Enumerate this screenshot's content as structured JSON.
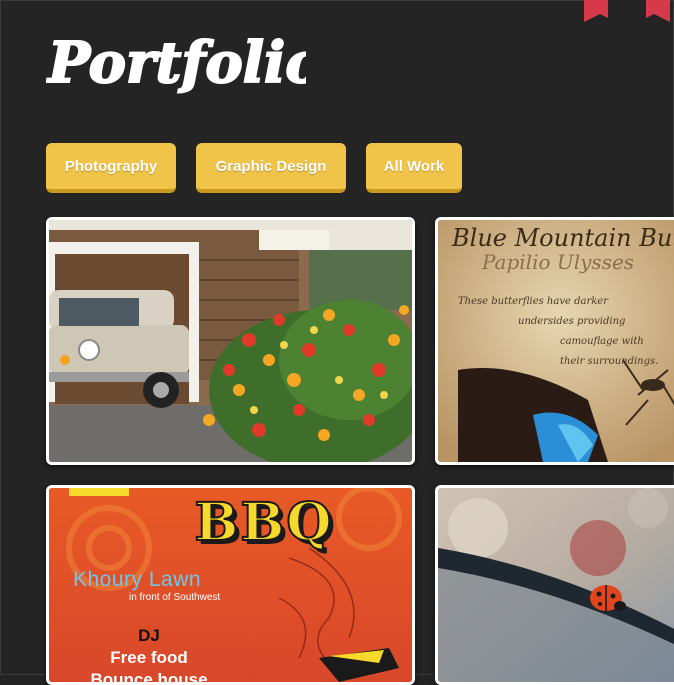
{
  "site": {
    "logo_text": "Portfolio",
    "ribbon_color": "#d63a4a"
  },
  "filters": [
    {
      "label": "Photography"
    },
    {
      "label": "Graphic Design"
    },
    {
      "label": "All Work"
    }
  ],
  "colors": {
    "background": "#252424",
    "button": "#f0c449",
    "button_shadow": "#c99a1f",
    "tile_border": "#ffffff"
  },
  "tiles": {
    "car_photo": {
      "subject": "vintage car and flowers"
    },
    "butterfly": {
      "title": "Blue Mountain But",
      "subtitle": "Papilio Ulysses",
      "note_lines": [
        "These butterflies have darker",
        "undersides providing",
        "camouflage with",
        "their surroundings."
      ]
    },
    "bbq_poster": {
      "title": "BBQ",
      "location": "Khoury Lawn",
      "location_detail": "in front of Southwest",
      "lines": [
        "DJ",
        "Free food",
        "Bounce house"
      ]
    },
    "ladybug": {
      "subject": "ladybug on a leaf"
    }
  }
}
